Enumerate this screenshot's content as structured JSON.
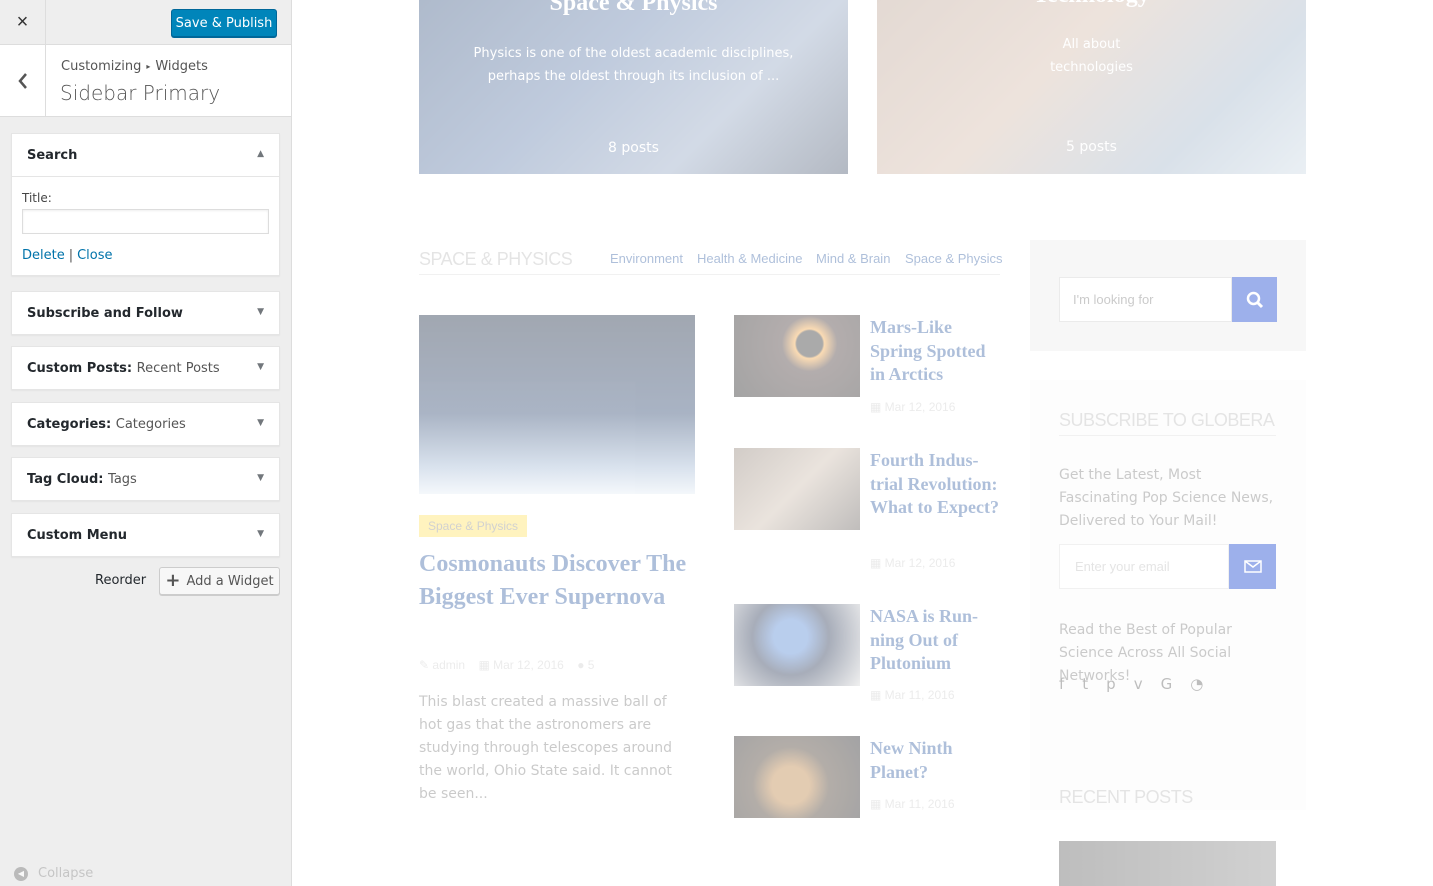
{
  "customizer": {
    "close_icon": "×",
    "save_label": "Save & Publish",
    "back_icon": "‹",
    "breadcrumb": [
      "Customizing",
      "Widgets"
    ],
    "breadcrumb_sep": "▸",
    "section_title": "Sidebar Primary",
    "widgets": [
      {
        "name": "Search",
        "sub": "",
        "expanded": true
      },
      {
        "name": "Subscribe and Follow",
        "sub": "",
        "expanded": false
      },
      {
        "name": "Custom Posts",
        "sub": "Recent Posts",
        "expanded": false
      },
      {
        "name": "Categories",
        "sub": "Categories",
        "expanded": false
      },
      {
        "name": "Tag Cloud",
        "sub": "Tags",
        "expanded": false
      },
      {
        "name": "Custom Menu",
        "sub": "",
        "expanded": false
      }
    ],
    "search_widget": {
      "title_label": "Title:",
      "title_value": "",
      "delete_label": "Delete",
      "separator": "|",
      "close_label": "Close"
    },
    "reorder_label": "Reorder",
    "add_widget_label": "Add a Widget",
    "collapse_label": "Collapse"
  },
  "preview": {
    "cards": [
      {
        "title": "Space & Physics",
        "description": "Physics is one of the oldest academic disciplines, perhaps the oldest through its inclusion of ...",
        "count": "8 posts"
      },
      {
        "title": "Technology",
        "description": "All about technologies",
        "count": "5 posts"
      }
    ],
    "section_title": "SPACE & PHYSICS",
    "tabs": [
      "Environment",
      "Health & Medicine",
      "Mind & Brain",
      "Space & Physics"
    ],
    "featured": {
      "tag": "Space & Physics",
      "title": "Cosmonauts Discover The Biggest Ever Super­nova",
      "author": "admin",
      "date": "Mar 12, 2016",
      "comments": "5",
      "excerpt": "This blast created a massive ball of hot gas that the astronomers are studying through telescopes around the world, Ohio State said. It cannot be seen..."
    },
    "side_posts": [
      {
        "title": "Mars-Like Spring Spotted in Arctics",
        "date": "Mar 12, 2016"
      },
      {
        "title": "Fourth Indus­trial Revolu­tion: What to Expect?",
        "date": "Mar 12, 2016"
      },
      {
        "title": "NASA is Run­ning Out of Plutonium",
        "date": "Mar 11, 2016"
      },
      {
        "title": "New Ninth Planet?",
        "date": "Mar 11, 2016"
      }
    ],
    "search_placeholder": "I'm looking for",
    "subscribe_title": "SUBSCRIBE TO GLOBERA",
    "subscribe_text": "Get the Latest, Most Fascinating Pop Science News, Delivered to Your Mail!",
    "email_placeholder": "Enter your email",
    "social_text": "Read the Best of Popular Science Across All Social Networks!",
    "social_icons": [
      "f",
      "t",
      "p",
      "v",
      "G",
      "rss"
    ],
    "recent_title": "RECENT POSTS"
  }
}
